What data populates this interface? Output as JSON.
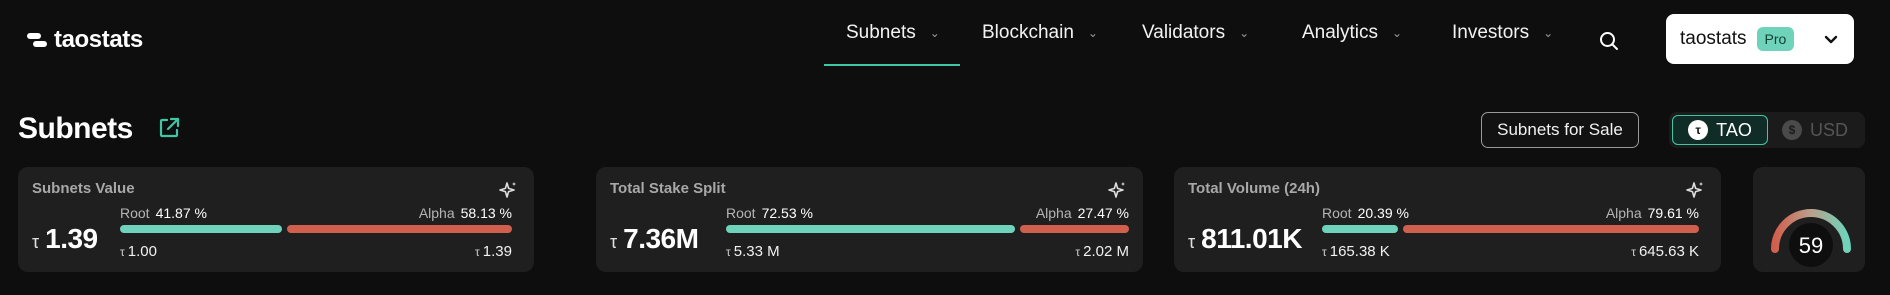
{
  "header": {
    "logo_text": "taostats",
    "nav": [
      {
        "label": "Subnets",
        "active": true
      },
      {
        "label": "Blockchain",
        "active": false
      },
      {
        "label": "Validators",
        "active": false
      },
      {
        "label": "Analytics",
        "active": false
      },
      {
        "label": "Investors",
        "active": false
      }
    ],
    "account": {
      "name": "taostats",
      "badge": "Pro"
    }
  },
  "page": {
    "title": "Subnets",
    "sale_button": "Subnets for Sale",
    "currency": {
      "options": [
        "TAO",
        "USD"
      ],
      "selected": "TAO"
    }
  },
  "cards": [
    {
      "title": "Subnets Value",
      "currency_symbol": "τ",
      "value": "1.39",
      "root_label": "Root",
      "root_pct": "41.87 %",
      "root_fraction": 0.4187,
      "alpha_label": "Alpha",
      "alpha_pct": "58.13 %",
      "root_amount": "1.00",
      "alpha_amount": "1.39"
    },
    {
      "title": "Total Stake Split",
      "currency_symbol": "τ",
      "value": "7.36M",
      "root_label": "Root",
      "root_pct": "72.53 %",
      "root_fraction": 0.7253,
      "alpha_label": "Alpha",
      "alpha_pct": "27.47 %",
      "root_amount": "5.33 M",
      "alpha_amount": "2.02 M"
    },
    {
      "title": "Total Volume (24h)",
      "currency_symbol": "τ",
      "value": "811.01K",
      "root_label": "Root",
      "root_pct": "20.39 %",
      "root_fraction": 0.2039,
      "alpha_label": "Alpha",
      "alpha_pct": "79.61 %",
      "root_amount": "165.38 K",
      "alpha_amount": "645.63 K"
    }
  ],
  "gauge": {
    "value": "59",
    "fraction": 0.59
  },
  "colors": {
    "accent": "#3fc7a4",
    "root": "#6fd3bb",
    "alpha": "#d15f4d",
    "background": "#0e0e0e",
    "card": "#1f1f1f"
  }
}
